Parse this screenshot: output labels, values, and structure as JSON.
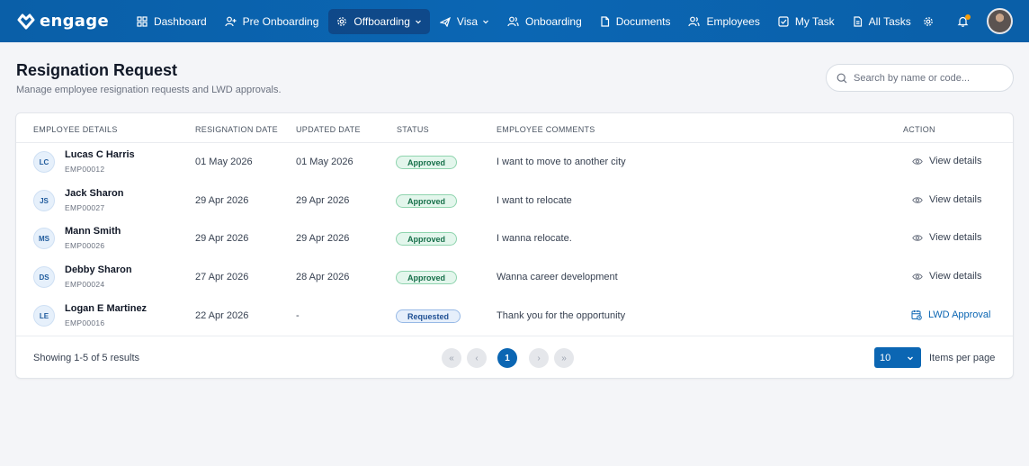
{
  "brand": {
    "name": "engage"
  },
  "nav": {
    "items": [
      {
        "label": "Dashboard",
        "icon": "dashboard-icon"
      },
      {
        "label": "Pre Onboarding",
        "icon": "user-plus-icon"
      },
      {
        "label": "Offboarding",
        "icon": "gear-icon",
        "active": true,
        "has_dropdown": true
      },
      {
        "label": "Visa",
        "icon": "plane-icon",
        "has_dropdown": true
      },
      {
        "label": "Onboarding",
        "icon": "users-icon"
      },
      {
        "label": "Documents",
        "icon": "document-icon"
      },
      {
        "label": "Employees",
        "icon": "users-icon"
      },
      {
        "label": "My Task",
        "icon": "checkbox-icon"
      },
      {
        "label": "All Tasks",
        "icon": "file-text-icon"
      }
    ],
    "right_icons": [
      "settings-icon",
      "bell-icon",
      "avatar"
    ],
    "accent": "#0b66b3",
    "notification_dot_color": "#f59e0b"
  },
  "page": {
    "title": "Resignation Request",
    "subtitle": "Manage employee resignation requests and LWD approvals."
  },
  "search": {
    "placeholder": "Search by name or code...",
    "value": ""
  },
  "table": {
    "columns": [
      "EMPLOYEE DETAILS",
      "RESIGNATION DATE",
      "UPDATED DATE",
      "STATUS",
      "EMPLOYEE COMMENTS",
      "ACTION"
    ],
    "rows": [
      {
        "initials": "LC",
        "name": "Lucas C Harris",
        "code": "EMP00012",
        "resignation_date": "01 May 2026",
        "updated_date": "01 May 2026",
        "status": "Approved",
        "comment": "I want to move to another city",
        "action": "View details",
        "action_icon": "eye-icon"
      },
      {
        "initials": "JS",
        "name": "Jack Sharon",
        "code": "EMP00027",
        "resignation_date": "29 Apr 2026",
        "updated_date": "29 Apr 2026",
        "status": "Approved",
        "comment": "I want to relocate",
        "action": "View details",
        "action_icon": "eye-icon"
      },
      {
        "initials": "MS",
        "name": "Mann Smith",
        "code": "EMP00026",
        "resignation_date": "29 Apr 2026",
        "updated_date": "29 Apr 2026",
        "status": "Approved",
        "comment": "I wanna relocate.",
        "action": "View details",
        "action_icon": "eye-icon"
      },
      {
        "initials": "DS",
        "name": "Debby Sharon",
        "code": "EMP00024",
        "resignation_date": "27 Apr 2026",
        "updated_date": "28 Apr 2026",
        "status": "Approved",
        "comment": "Wanna career development",
        "action": "View details",
        "action_icon": "eye-icon"
      },
      {
        "initials": "LE",
        "name": "Logan E Martinez",
        "code": "EMP00016",
        "resignation_date": "22 Apr 2026",
        "updated_date": "-",
        "status": "Requested",
        "comment": "Thank you for the opportunity",
        "action": "LWD Approval",
        "action_icon": "calendar-icon"
      }
    ]
  },
  "pagination": {
    "summary": "Showing 1-5 of 5 results",
    "first": "«",
    "prev": "‹",
    "current_page": "1",
    "next": "›",
    "last": "»",
    "per_page_value": "10",
    "per_page_label": "Items per page"
  },
  "colors": {
    "approved_bg": "#e3f6ec",
    "approved_text": "#17704a",
    "requested_bg": "#e6effb",
    "requested_text": "#1e4f93"
  }
}
